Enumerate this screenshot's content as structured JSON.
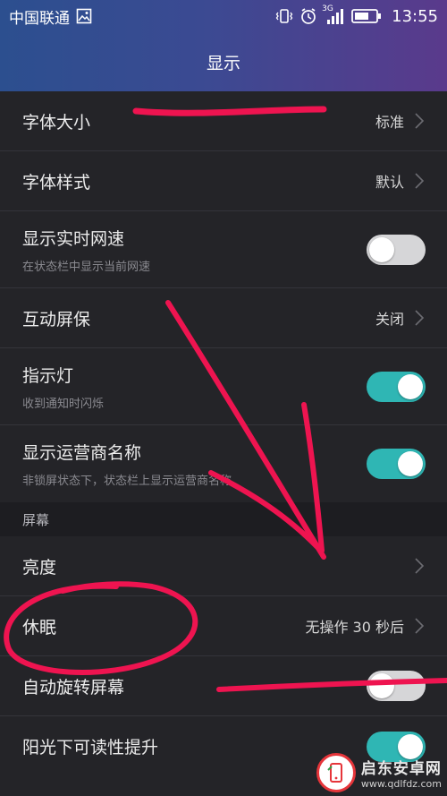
{
  "status_bar": {
    "carrier": "中国联通",
    "network": "3G",
    "time": "13:55"
  },
  "header": {
    "title": "显示"
  },
  "settings": [
    {
      "title": "字体大小",
      "value": "标准",
      "type": "nav"
    },
    {
      "title": "字体样式",
      "value": "默认",
      "type": "nav"
    },
    {
      "title": "显示实时网速",
      "subtitle": "在状态栏中显示当前网速",
      "type": "toggle",
      "state": "off"
    },
    {
      "title": "互动屏保",
      "value": "关闭",
      "type": "nav"
    },
    {
      "title": "指示灯",
      "subtitle": "收到通知时闪烁",
      "type": "toggle",
      "state": "on"
    },
    {
      "title": "显示运营商名称",
      "subtitle": "非锁屏状态下，状态栏上显示运营商名称",
      "type": "toggle",
      "state": "on"
    }
  ],
  "screen_section": {
    "label": "屏幕",
    "items": [
      {
        "title": "亮度",
        "type": "nav"
      },
      {
        "title": "休眠",
        "value": "无操作 30 秒后",
        "type": "nav"
      },
      {
        "title": "自动旋转屏幕",
        "type": "toggle",
        "state": "off"
      },
      {
        "title": "阳光下可读性提升",
        "type": "toggle",
        "state": "on"
      }
    ]
  },
  "watermark": {
    "title": "启东安卓网",
    "url": "www.qdlfdz.com"
  },
  "colors": {
    "accent_toggle": "#2fb6b4",
    "annotation": "#ee1450",
    "background": "#242428"
  }
}
